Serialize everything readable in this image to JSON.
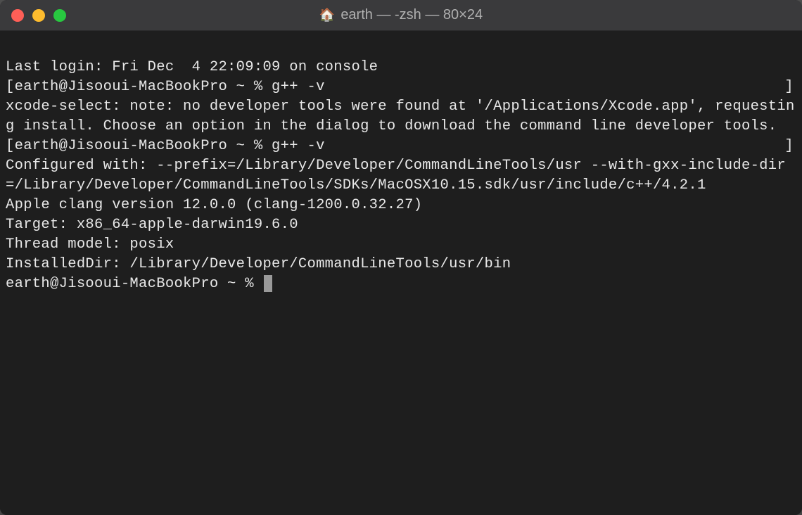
{
  "window": {
    "title": "earth — -zsh — 80×24",
    "icon": "home-icon"
  },
  "terminal": {
    "lines": [
      "Last login: Fri Dec  4 22:09:09 on console",
      "[earth@Jisooui-MacBookPro ~ % g++ -v",
      "xcode-select: note: no developer tools were found at '/Applications/Xcode.app', requesting install. Choose an option in the dialog to download the command line developer tools.",
      "[earth@Jisooui-MacBookPro ~ % g++ -v",
      "Configured with: --prefix=/Library/Developer/CommandLineTools/usr --with-gxx-include-dir=/Library/Developer/CommandLineTools/SDKs/MacOSX10.15.sdk/usr/include/c++/4.2.1",
      "Apple clang version 12.0.0 (clang-1200.0.32.27)",
      "Target: x86_64-apple-darwin19.6.0",
      "Thread model: posix",
      "InstalledDir: /Library/Developer/CommandLineTools/usr/bin",
      "earth@Jisooui-MacBookPro ~ % "
    ],
    "right_bracket": "]"
  }
}
